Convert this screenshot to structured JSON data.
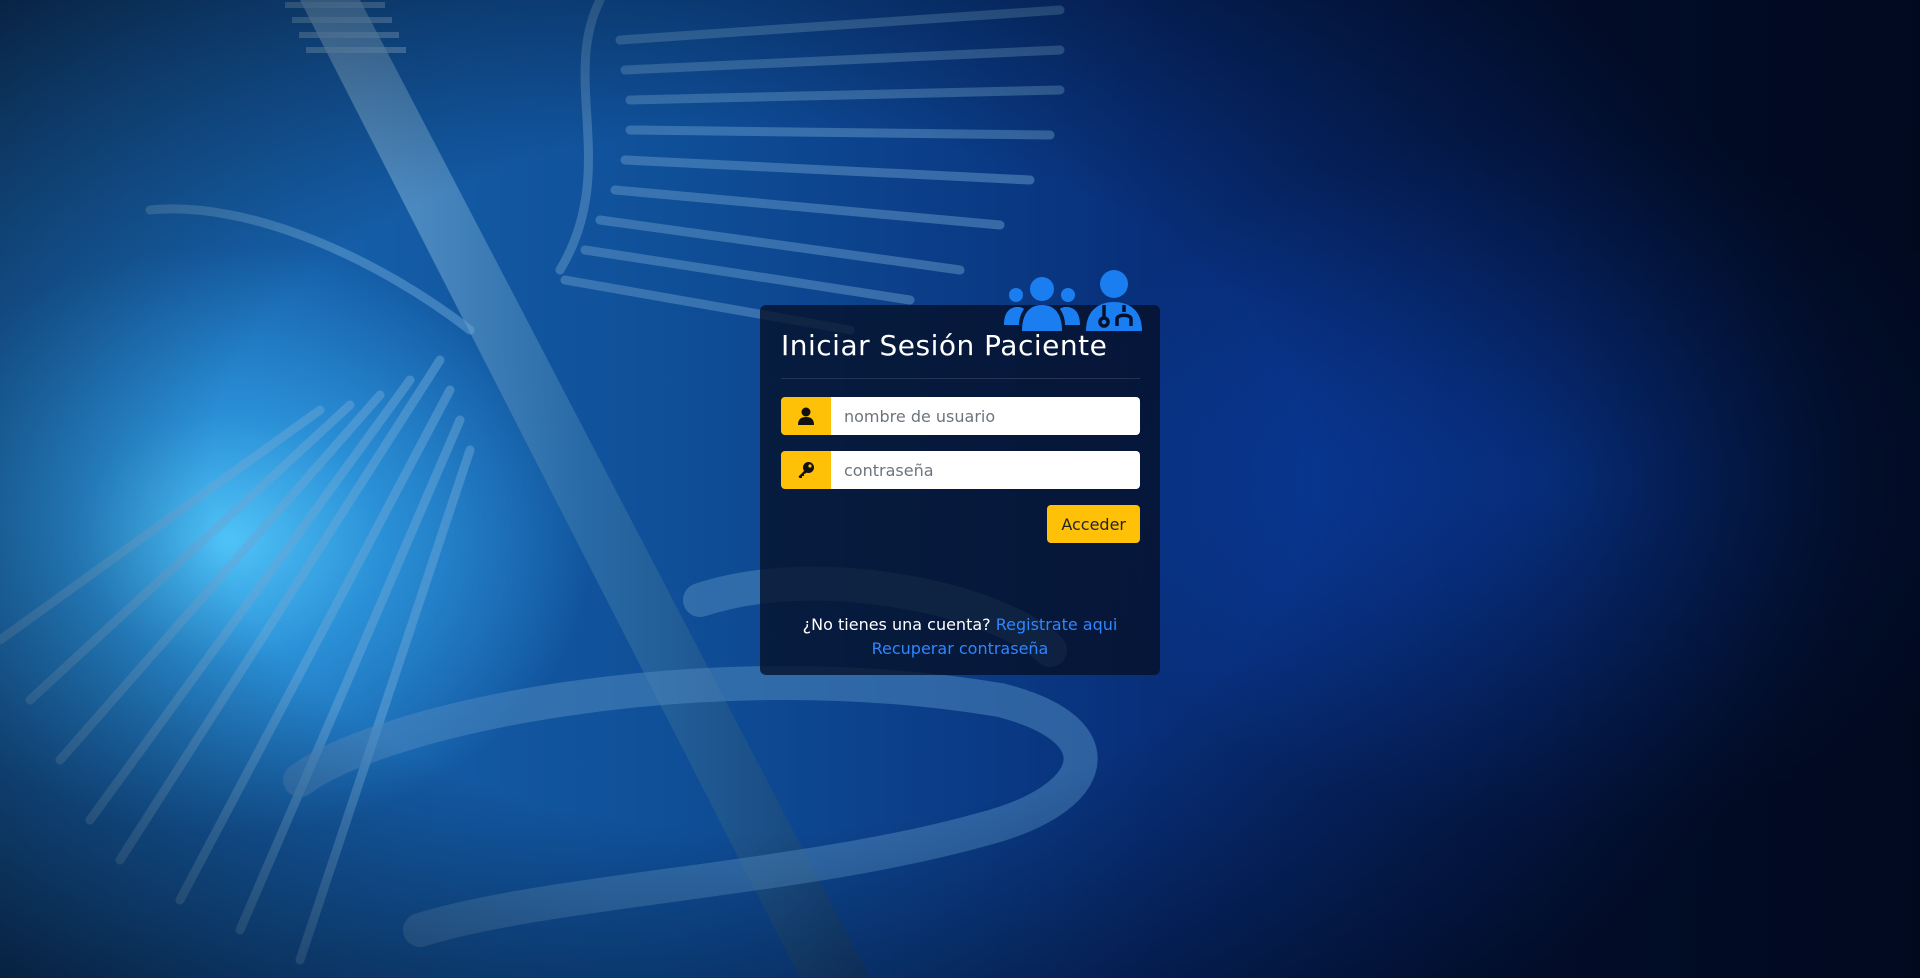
{
  "login": {
    "title": "Iniciar Sesión Paciente",
    "username_placeholder": "nombre de usuario",
    "password_placeholder": "contraseña",
    "submit_label": "Acceder",
    "no_account_text": "¿No tienes una cuenta?",
    "register_link": "Registrate aqui",
    "recover_link": "Recuperar contraseña"
  },
  "icons": {
    "header": [
      "users-icon",
      "user-doctor-icon"
    ],
    "username_addon": "user-icon",
    "password_addon": "key-icon"
  },
  "colors": {
    "accent": "#ffc107",
    "link": "#2f86ff",
    "icon_blue": "#1b7ef0",
    "card_bg": "#05102a"
  }
}
